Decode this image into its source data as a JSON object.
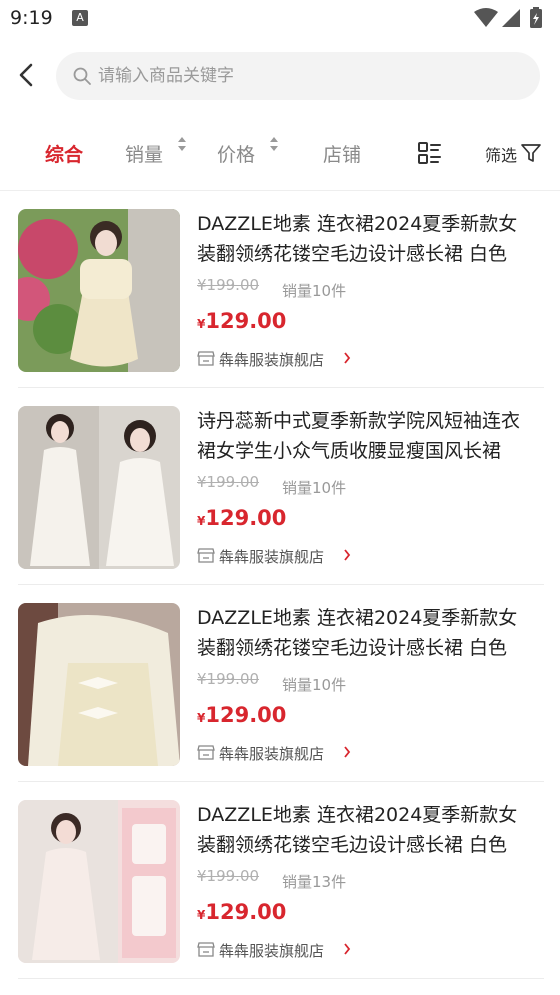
{
  "status_bar": {
    "time": "9:19",
    "notif_icon": "a-icon"
  },
  "search": {
    "placeholder": "请输入商品关键字"
  },
  "sort_tabs": [
    {
      "label": "综合",
      "active": true
    },
    {
      "label": "销量",
      "active": false
    },
    {
      "label": "价格",
      "active": false
    },
    {
      "label": "店铺",
      "active": false
    }
  ],
  "filter_label": "筛选",
  "colors": {
    "accent": "#d8262e",
    "muted": "#8a8a8a"
  },
  "products": [
    {
      "title": "DAZZLE地素 连衣裙2024夏季新款女装翻领绣花镂空毛边设计感长裙 白色",
      "orig_price": "¥199.00",
      "sales": "销量10件",
      "currency": "¥",
      "price": "129.00",
      "shop": "犇犇服装旗舰店"
    },
    {
      "title": "诗丹蕊新中式夏季新款学院风短袖连衣裙女学生小众气质收腰显瘦国风长裙",
      "orig_price": "¥199.00",
      "sales": "销量10件",
      "currency": "¥",
      "price": "129.00",
      "shop": "犇犇服装旗舰店"
    },
    {
      "title": "DAZZLE地素 连衣裙2024夏季新款女装翻领绣花镂空毛边设计感长裙 白色",
      "orig_price": "¥199.00",
      "sales": "销量10件",
      "currency": "¥",
      "price": "129.00",
      "shop": "犇犇服装旗舰店"
    },
    {
      "title": "DAZZLE地素 连衣裙2024夏季新款女装翻领绣花镂空毛边设计感长裙 白色",
      "orig_price": "¥199.00",
      "sales": "销量13件",
      "currency": "¥",
      "price": "129.00",
      "shop": "犇犇服装旗舰店"
    }
  ]
}
